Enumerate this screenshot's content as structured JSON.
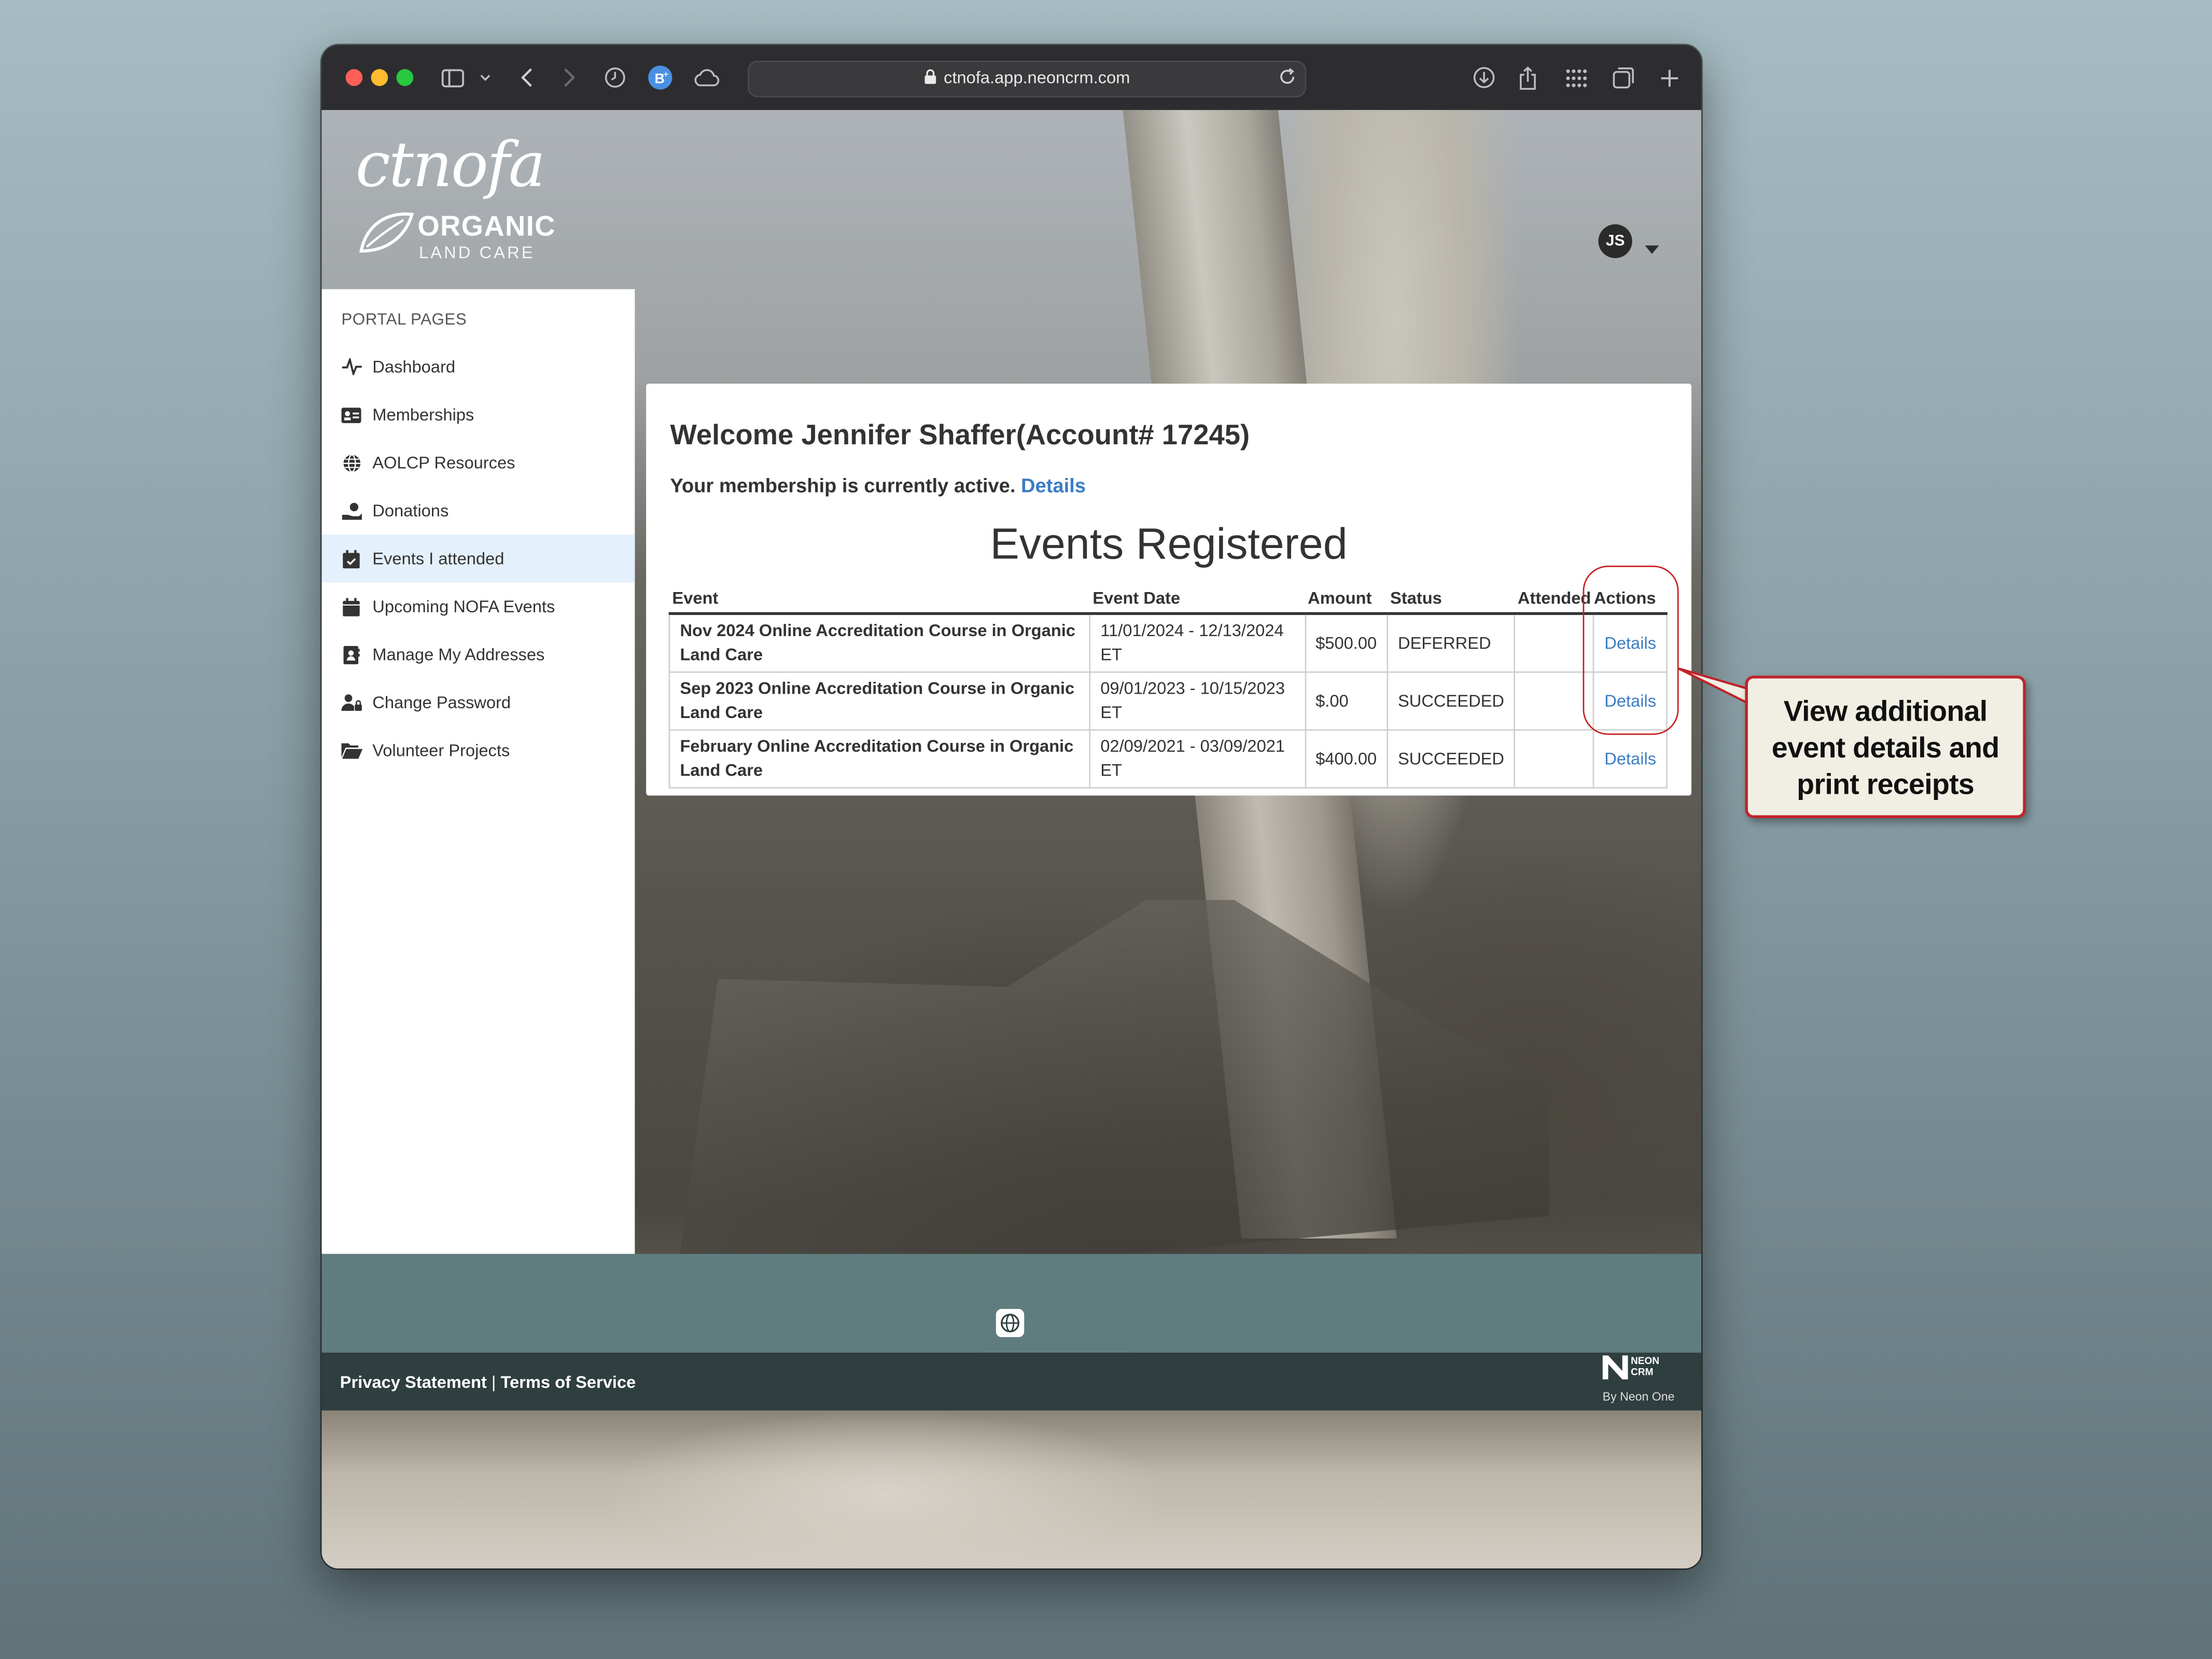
{
  "browser": {
    "url": "ctnofa.app.neoncrm.com"
  },
  "header": {
    "logo_wordmark": "ctnofa",
    "logo_organic": "ORGANIC",
    "logo_land_care": "LAND CARE",
    "avatar_initials": "JS"
  },
  "sidebar": {
    "title": "PORTAL PAGES",
    "items": [
      {
        "label": "Dashboard",
        "icon": "activity-icon"
      },
      {
        "label": "Memberships",
        "icon": "id-card-icon"
      },
      {
        "label": "AOLCP Resources",
        "icon": "globe-icon"
      },
      {
        "label": "Donations",
        "icon": "hand-holding-icon"
      },
      {
        "label": "Events I attended",
        "icon": "calendar-check-icon",
        "active": true
      },
      {
        "label": "Upcoming NOFA Events",
        "icon": "calendar-icon"
      },
      {
        "label": "Manage My Addresses",
        "icon": "address-book-icon"
      },
      {
        "label": "Change Password",
        "icon": "user-lock-icon"
      },
      {
        "label": "Volunteer Projects",
        "icon": "folder-open-icon"
      }
    ]
  },
  "main": {
    "welcome": "Welcome Jennifer Shaffer(Account# 17245)",
    "status_text": "Your membership is currently active.",
    "status_link": "Details",
    "events_title": "Events Registered",
    "table": {
      "headers": [
        "Event",
        "Event Date",
        "Amount",
        "Status",
        "Attended",
        "Actions"
      ],
      "rows": [
        {
          "event": "Nov 2024 Online Accreditation Course in Organic Land Care",
          "date": "11/01/2024 - 12/13/2024 ET",
          "amount": "$500.00",
          "status": "DEFERRED",
          "attended": "",
          "action": "Details"
        },
        {
          "event": "Sep 2023 Online Accreditation Course in Organic Land Care",
          "date": "09/01/2023 - 10/15/2023 ET",
          "amount": "$.00",
          "status": "SUCCEEDED",
          "attended": "",
          "action": "Details"
        },
        {
          "event": "February Online Accreditation Course in Organic Land Care",
          "date": "02/09/2021 - 03/09/2021 ET",
          "amount": "$400.00",
          "status": "SUCCEEDED",
          "attended": "",
          "action": "Details"
        }
      ]
    }
  },
  "footer": {
    "privacy": "Privacy Statement",
    "separator": " | ",
    "terms": "Terms of Service",
    "neon_line1": "NEON",
    "neon_line2": "CRM",
    "neon_by": "By Neon One"
  },
  "callout": {
    "text": "View additional event details and print receipts"
  },
  "colors": {
    "accent_link": "#3b7cc4",
    "callout_border": "#c0232a",
    "footer_teal": "#5f7d7f",
    "footer_dark": "#2f3e3f"
  }
}
